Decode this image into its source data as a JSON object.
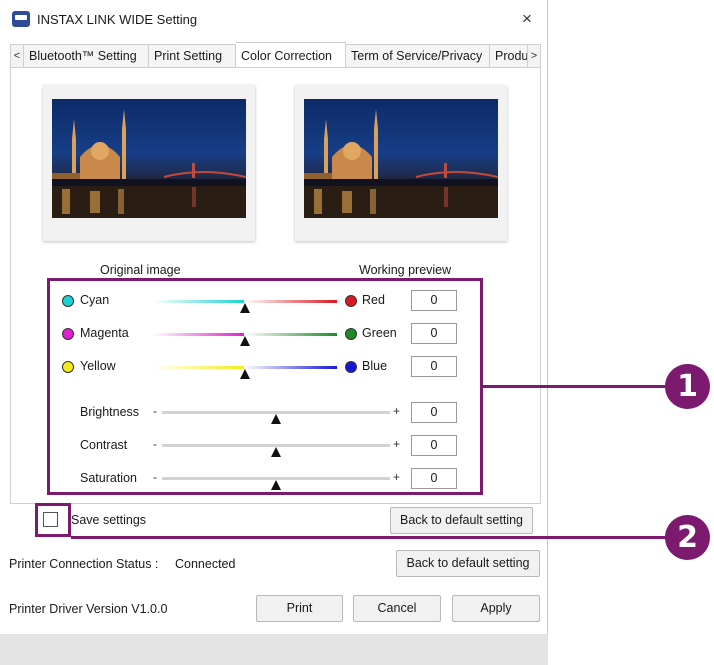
{
  "window": {
    "title": "INSTAX LINK WIDE Setting",
    "close_glyph": "×"
  },
  "tabs": {
    "prev_arrow": "<",
    "next_arrow": ">",
    "items": [
      {
        "label": "Bluetooth™ Setting"
      },
      {
        "label": "Print Setting"
      },
      {
        "label": "Color Correction",
        "active": true
      },
      {
        "label": "Term of Service/Privacy"
      },
      {
        "label": "Produ"
      }
    ]
  },
  "images": {
    "original_caption": "Original image",
    "preview_caption": "Working preview"
  },
  "color_balance": [
    {
      "left": "Cyan",
      "left_color": "#19d3d3",
      "right": "Red",
      "right_color": "#d81b22",
      "value": "0"
    },
    {
      "left": "Magenta",
      "left_color": "#e020d0",
      "right": "Green",
      "right_color": "#1f8a2a",
      "value": "0"
    },
    {
      "left": "Yellow",
      "left_color": "#f4ec1a",
      "right": "Blue",
      "right_color": "#1717d9",
      "value": "0"
    }
  ],
  "adjustments": [
    {
      "label": "Brightness",
      "minus": "-",
      "plus": "+",
      "value": "0"
    },
    {
      "label": "Contrast",
      "minus": "-",
      "plus": "+",
      "value": "0"
    },
    {
      "label": "Saturation",
      "minus": "-",
      "plus": "+",
      "value": "0"
    }
  ],
  "save": {
    "label": "Save settings",
    "checked": false
  },
  "tab_reset_button": "Back to default setting",
  "status": {
    "connection_label": "Printer Connection Status :",
    "connection_value": "Connected",
    "driver_version": "Printer Driver Version V1.0.0"
  },
  "window_reset_button": "Back to default setting",
  "actions": {
    "print": "Print",
    "cancel": "Cancel",
    "apply": "Apply"
  },
  "callouts": [
    {
      "number": "1"
    },
    {
      "number": "2"
    }
  ],
  "colors": {
    "accent": "#7b1a6f"
  }
}
